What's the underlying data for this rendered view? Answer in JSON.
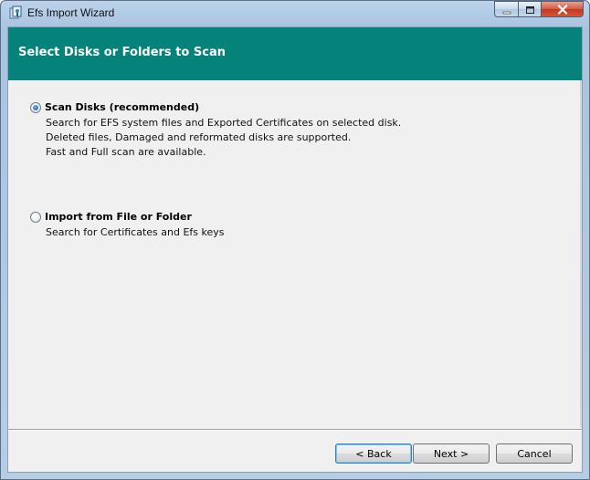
{
  "window": {
    "title": "Efs Import Wizard",
    "icon": "efs-wizard-icon"
  },
  "header": {
    "title": "Select Disks or Folders to Scan",
    "color": "#058279"
  },
  "options": [
    {
      "label": "Scan Disks (recommended)",
      "selected": true,
      "description": [
        "Search for EFS system files and Exported Certificates on selected disk.",
        "Deleted files, Damaged and reformated disks are supported.",
        "Fast  and Full scan are available."
      ]
    },
    {
      "label": "Import from File or Folder",
      "selected": false,
      "description": [
        "Search for Certificates and Efs keys"
      ]
    }
  ],
  "buttons": {
    "back": "< Back",
    "next": "Next >",
    "cancel": "Cancel"
  }
}
